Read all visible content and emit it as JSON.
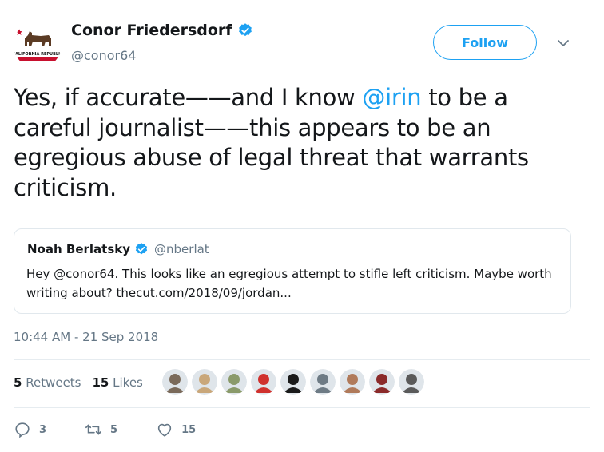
{
  "author": {
    "name": "Conor Friedersdorf",
    "handle": "@conor64",
    "avatar_text": "CALIFORNIA REPUBLIC"
  },
  "follow_label": "Follow",
  "tweet": {
    "text_1": "Yes, if accurate——and I know ",
    "mention": "@irin",
    "text_2": " to be a careful journalist——this appears to be an egregious abuse of legal threat that warrants criticism."
  },
  "quote": {
    "name": "Noah Berlatsky",
    "handle": "@nberlat",
    "text": "Hey @conor64. This looks like an egregious attempt to stifle left criticism. Maybe worth writing about? thecut.com/2018/09/jordan..."
  },
  "timestamp": "10:44 AM - 21 Sep 2018",
  "stats": {
    "retweets_count": "5",
    "retweets_label": "Retweets",
    "likes_count": "15",
    "likes_label": "Likes"
  },
  "likers": [
    "#7a6a5a",
    "#c9a77a",
    "#8a9a6a",
    "#d0312d",
    "#1a1a1a",
    "#6e7b85",
    "#b07a5a",
    "#8b2a2a",
    "#5a5a5a"
  ],
  "actions": {
    "reply_count": "3",
    "retweet_count": "5",
    "like_count": "15"
  },
  "colors": {
    "accent": "#1da1f2",
    "muted": "#657786",
    "text": "#14171a",
    "border": "#e1e8ed"
  }
}
